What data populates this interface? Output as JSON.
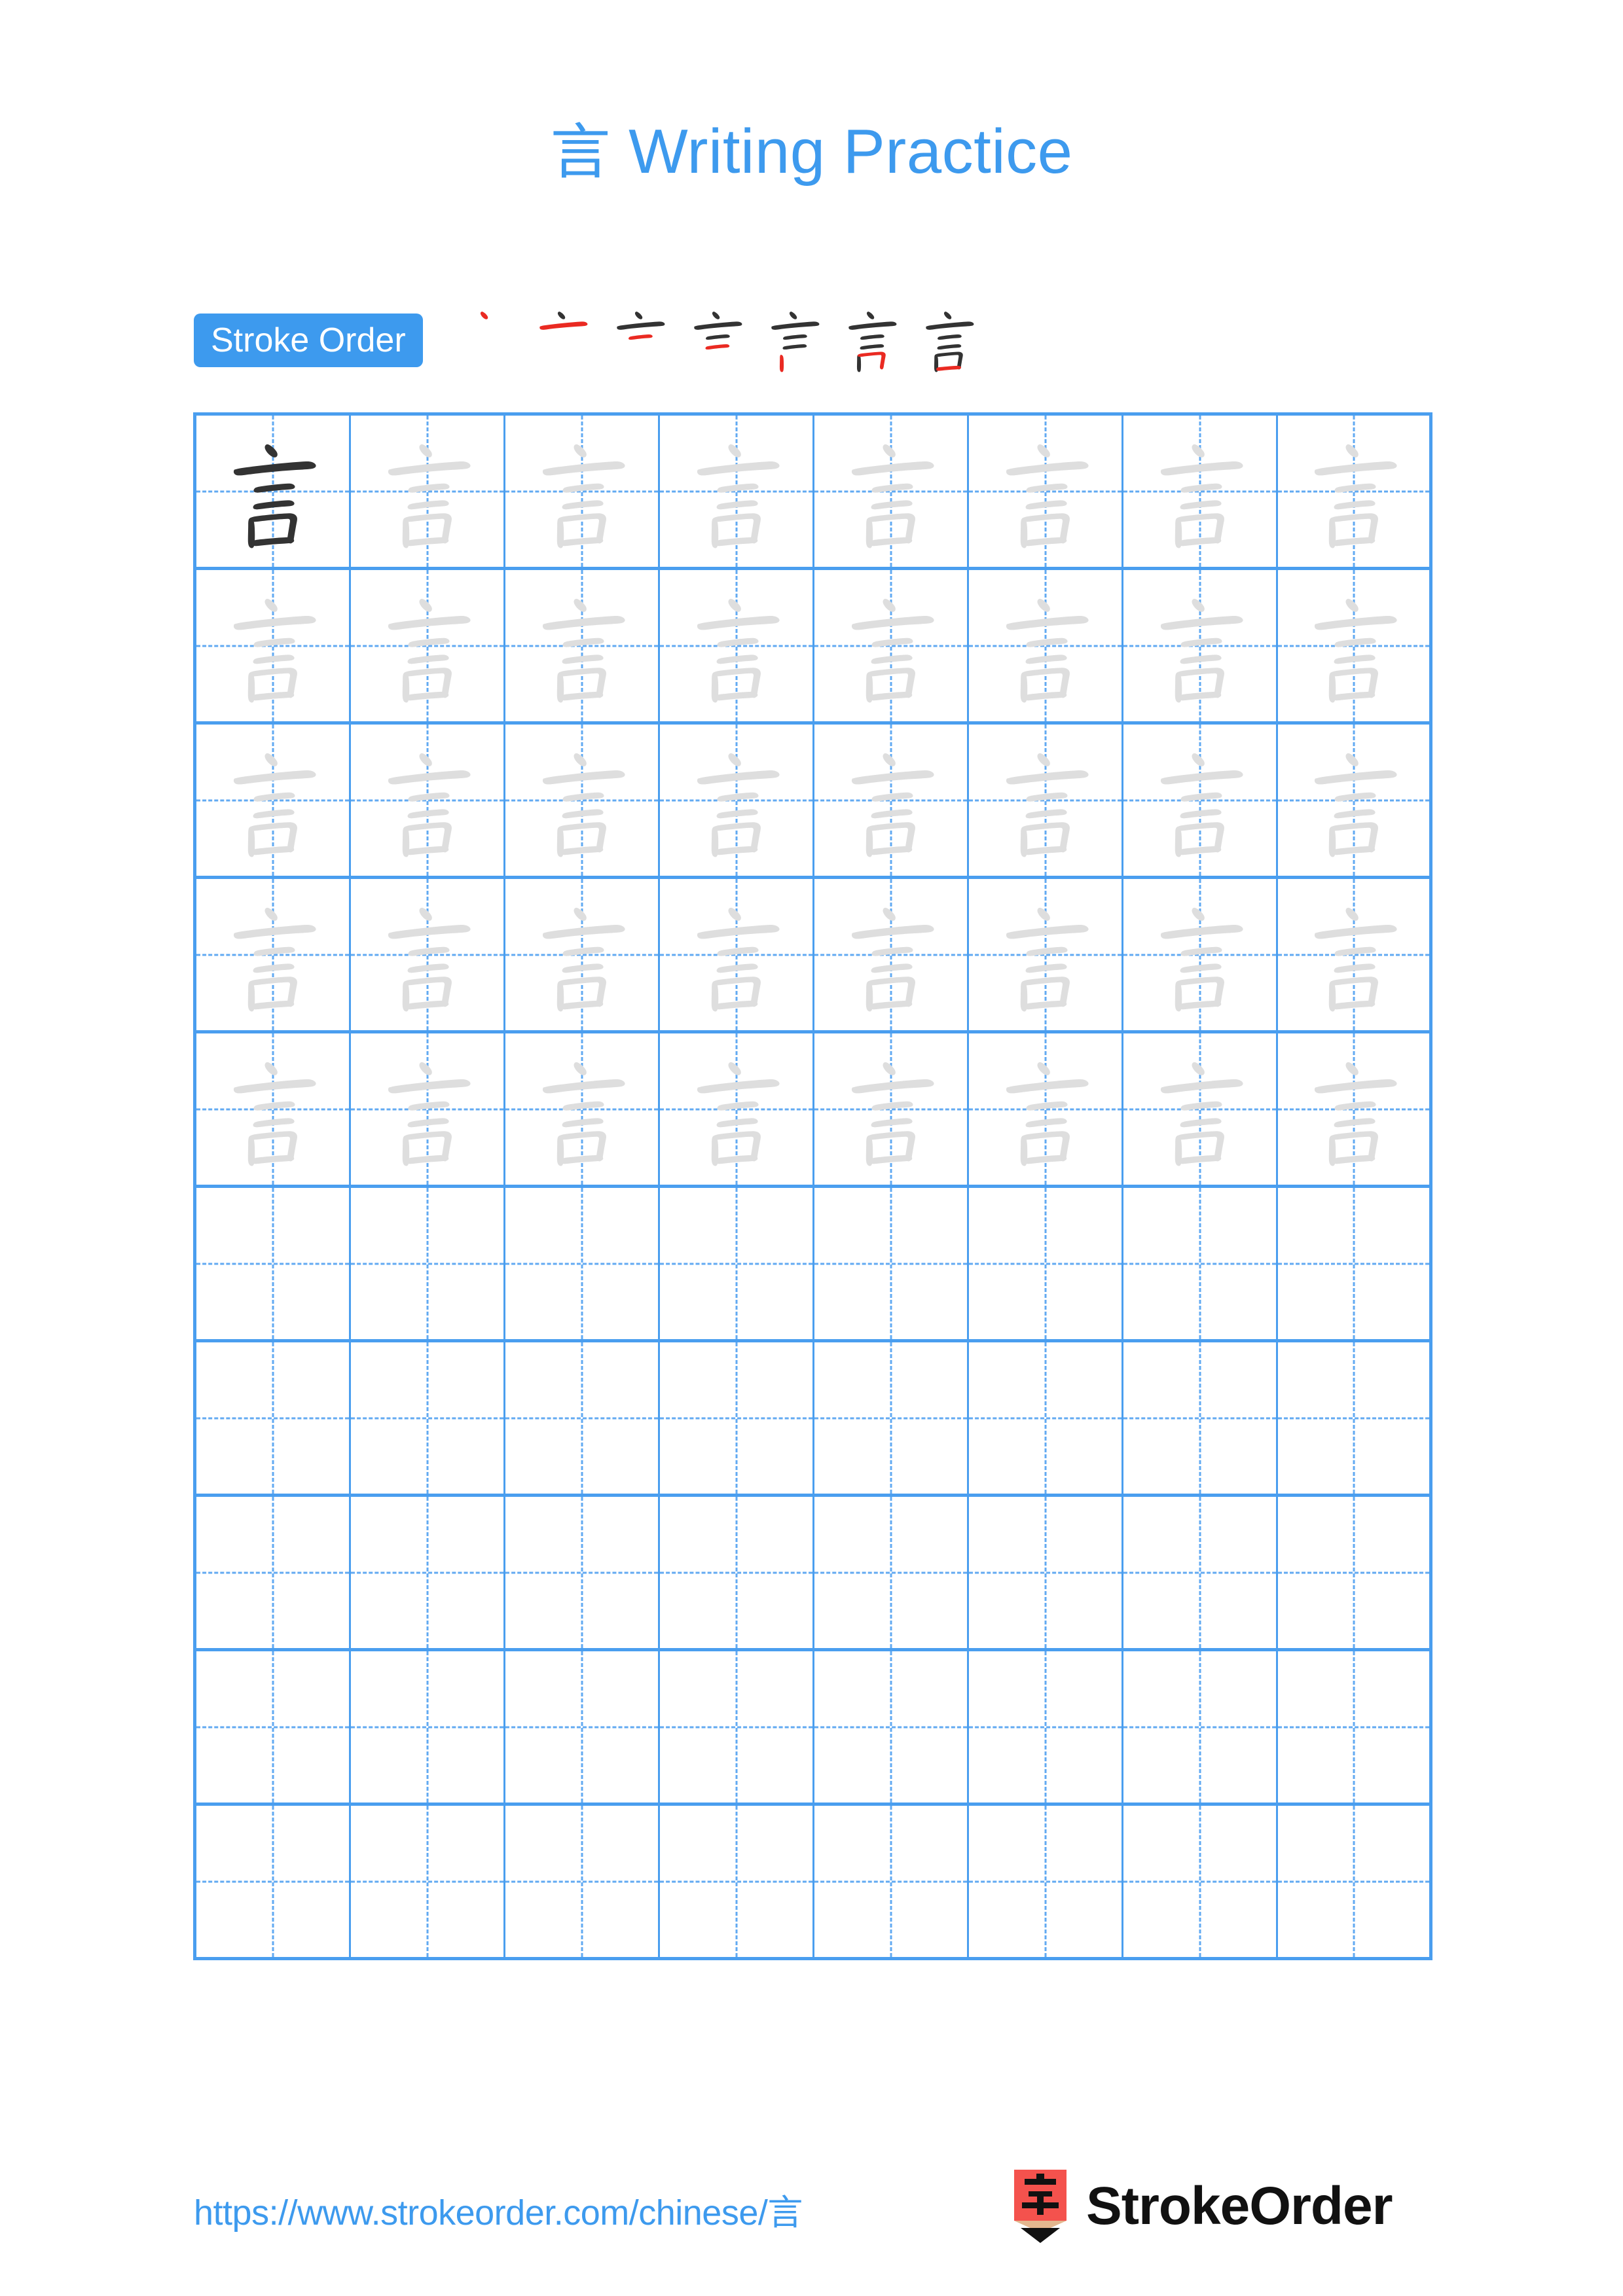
{
  "page": {
    "character": "言",
    "title_prefix": "言",
    "title_text": " Writing Practice",
    "title_full": "言 Writing Practice",
    "accent_color": "#3d9aee",
    "grid_line_color": "#4a9eef",
    "dark_stroke_color": "#333333",
    "light_stroke_color": "#dedede",
    "new_stroke_color": "#ea2a22",
    "background_color": "#ffffff"
  },
  "stroke_order": {
    "label": "Stroke Order",
    "total_strokes": 7,
    "steps": [
      {
        "index": 1,
        "strokes_shown": 1,
        "new_stroke": "dot"
      },
      {
        "index": 2,
        "strokes_shown": 2,
        "new_stroke": "long-horizontal"
      },
      {
        "index": 3,
        "strokes_shown": 3,
        "new_stroke": "short-horizontal-upper"
      },
      {
        "index": 4,
        "strokes_shown": 4,
        "new_stroke": "short-horizontal-lower"
      },
      {
        "index": 5,
        "strokes_shown": 5,
        "new_stroke": "box-left-vertical"
      },
      {
        "index": 6,
        "strokes_shown": 6,
        "new_stroke": "box-top-and-right"
      },
      {
        "index": 7,
        "strokes_shown": 7,
        "new_stroke": "box-bottom-horizontal"
      }
    ]
  },
  "practice_grid": {
    "columns": 8,
    "rows": 10,
    "filled_rows": 5,
    "empty_rows": 5,
    "first_cell_style": "solid-dark",
    "trace_cell_style": "light-gray",
    "cells": [
      [
        "dark",
        "trace",
        "trace",
        "trace",
        "trace",
        "trace",
        "trace",
        "trace"
      ],
      [
        "trace",
        "trace",
        "trace",
        "trace",
        "trace",
        "trace",
        "trace",
        "trace"
      ],
      [
        "trace",
        "trace",
        "trace",
        "trace",
        "trace",
        "trace",
        "trace",
        "trace"
      ],
      [
        "trace",
        "trace",
        "trace",
        "trace",
        "trace",
        "trace",
        "trace",
        "trace"
      ],
      [
        "trace",
        "trace",
        "trace",
        "trace",
        "trace",
        "trace",
        "trace",
        "trace"
      ],
      [
        "empty",
        "empty",
        "empty",
        "empty",
        "empty",
        "empty",
        "empty",
        "empty"
      ],
      [
        "empty",
        "empty",
        "empty",
        "empty",
        "empty",
        "empty",
        "empty",
        "empty"
      ],
      [
        "empty",
        "empty",
        "empty",
        "empty",
        "empty",
        "empty",
        "empty",
        "empty"
      ],
      [
        "empty",
        "empty",
        "empty",
        "empty",
        "empty",
        "empty",
        "empty",
        "empty"
      ],
      [
        "empty",
        "empty",
        "empty",
        "empty",
        "empty",
        "empty",
        "empty",
        "empty"
      ]
    ]
  },
  "footer": {
    "url": "https://www.strokeorder.com/chinese/言",
    "brand_name": "StrokeOrder",
    "brand_icon_character": "字",
    "brand_icon_color": "#f4524d"
  }
}
